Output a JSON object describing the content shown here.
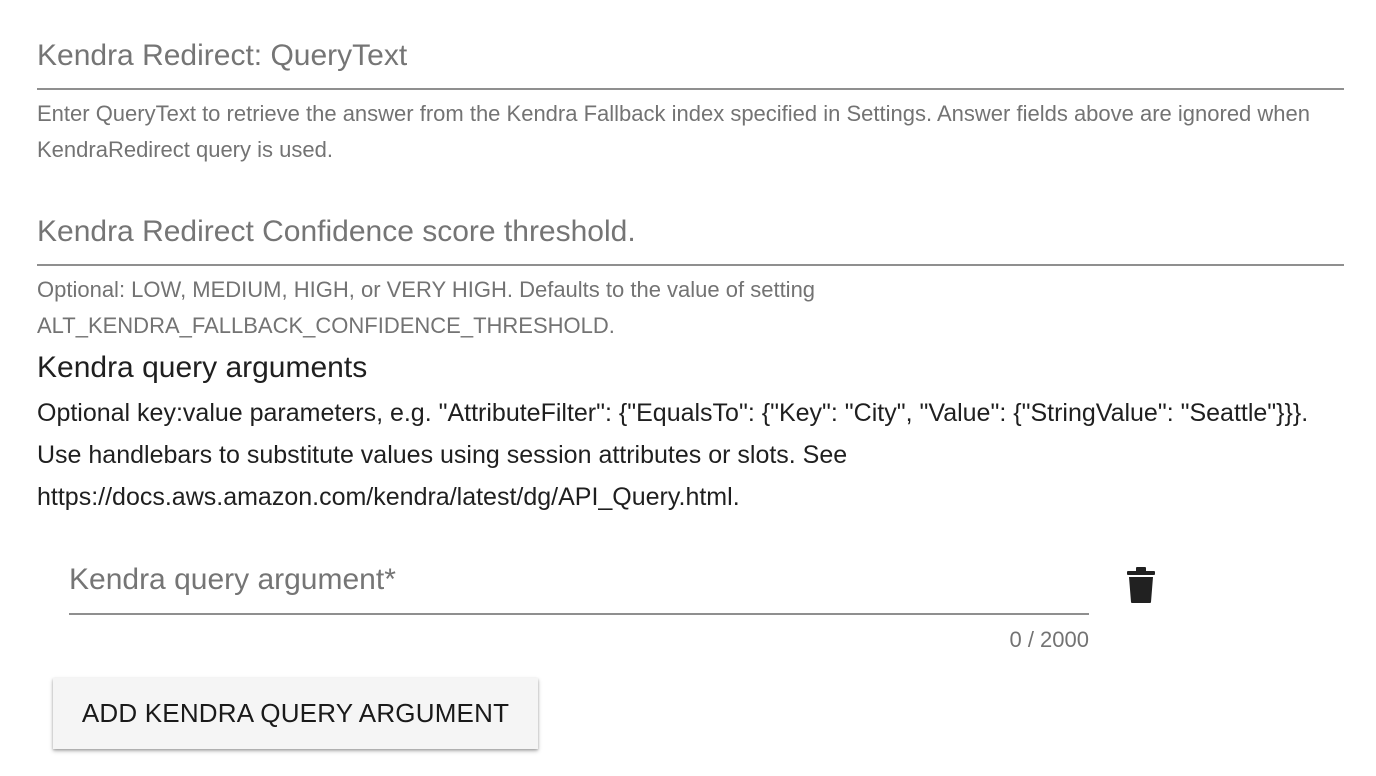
{
  "kendra_redirect": {
    "query_text_placeholder": "Kendra Redirect: QueryText",
    "query_text_value": "",
    "query_text_hint": "Enter QueryText to retrieve the answer from the Kendra Fallback index specified in Settings. Answer fields above are ignored when KendraRedirect query is used.",
    "confidence_placeholder": "Kendra Redirect Confidence score threshold.",
    "confidence_value": "",
    "confidence_hint": "Optional: LOW, MEDIUM, HIGH, or VERY HIGH. Defaults to the value of setting ALT_KENDRA_FALLBACK_CONFIDENCE_THRESHOLD."
  },
  "query_arguments": {
    "title": "Kendra query arguments",
    "description": "Optional key:value parameters, e.g. \"AttributeFilter\": {\"EqualsTo\": {\"Key\": \"City\", \"Value\": {\"StringValue\": \"Seattle\"}}}. Use handlebars to substitute values using session attributes or slots. See https://docs.aws.amazon.com/kendra/latest/dg/API_Query.html.",
    "argument_placeholder": "Kendra query argument*",
    "argument_value": "",
    "char_counter": "0 / 2000",
    "delete_icon": "trash-icon",
    "add_button_label": "ADD KENDRA QUERY ARGUMENT"
  }
}
